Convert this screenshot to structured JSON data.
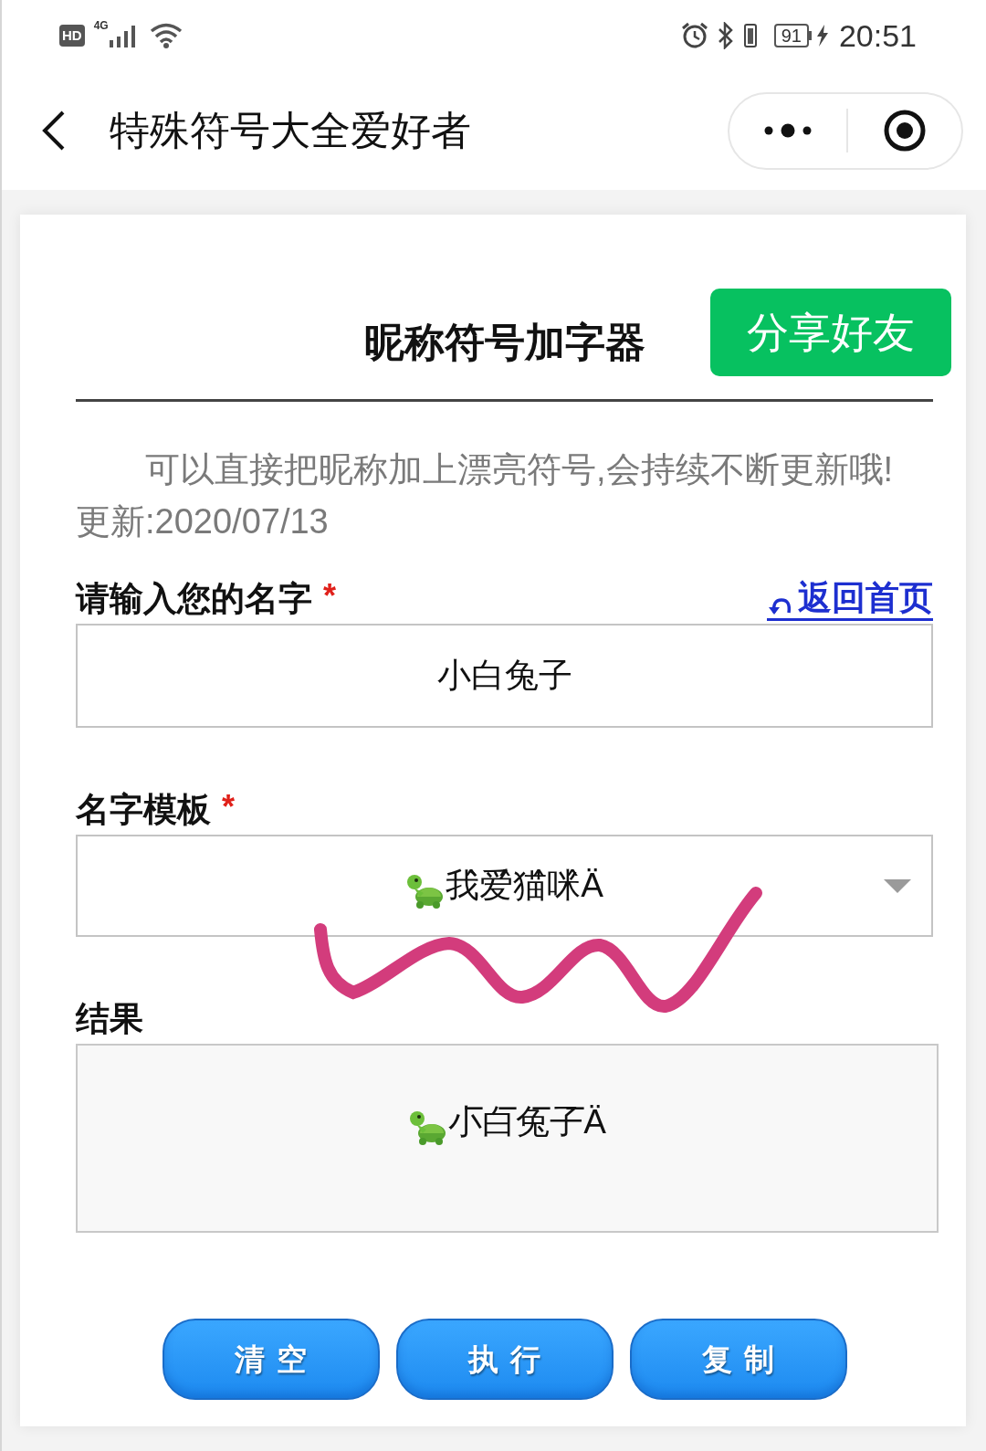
{
  "status_bar": {
    "hd_badge": "HD",
    "network": "4G",
    "battery": "91",
    "time": "20:51"
  },
  "nav_bar": {
    "title": "特殊符号大全爱好者"
  },
  "card": {
    "title": "昵称符号加字器",
    "share_button": "分享好友",
    "description": "可以直接把昵称加上漂亮符号,会持续不断更新哦!",
    "updated": "更新:2020/07/13",
    "fields": [
      {
        "kind": "input",
        "label": "请输入您的名字",
        "required_mark": "*",
        "link": "返回首页",
        "value": "小白兔子"
      },
      {
        "kind": "select",
        "label": "名字模板",
        "required_mark": "*",
        "value": "我̂爱̂猫̂咪̂Ä"
      },
      {
        "kind": "output",
        "label": "结果",
        "value": "小̅白̅兔̅子̅Ä"
      }
    ],
    "buttons": [
      "清空",
      "执行",
      "复制"
    ]
  }
}
